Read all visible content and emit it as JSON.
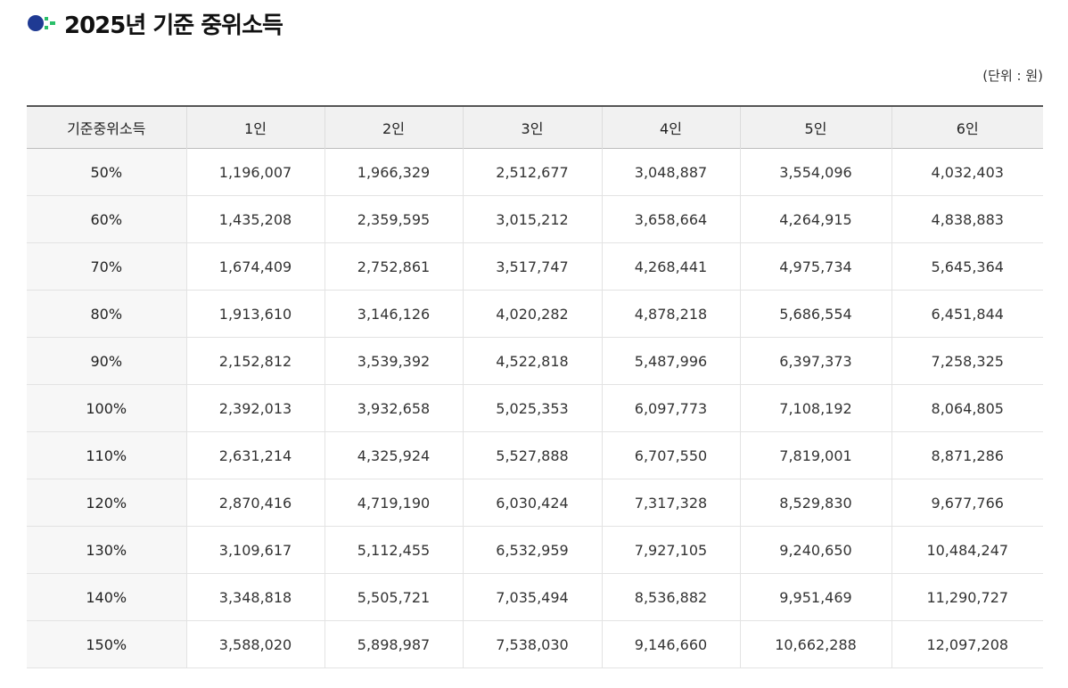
{
  "title": "2025년 기준 중위소득",
  "unit_note": "(단위 : 원)",
  "colors": {
    "icon_blue": "#1f3a93",
    "icon_green": "#2bbf6a",
    "header_bg": "#f1f1f1",
    "first_col_bg": "#f7f7f7"
  },
  "table": {
    "headers": [
      "기준중위소득",
      "1인",
      "2인",
      "3인",
      "4인",
      "5인",
      "6인"
    ],
    "rows": [
      [
        "50%",
        "1,196,007",
        "1,966,329",
        "2,512,677",
        "3,048,887",
        "3,554,096",
        "4,032,403"
      ],
      [
        "60%",
        "1,435,208",
        "2,359,595",
        "3,015,212",
        "3,658,664",
        "4,264,915",
        "4,838,883"
      ],
      [
        "70%",
        "1,674,409",
        "2,752,861",
        "3,517,747",
        "4,268,441",
        "4,975,734",
        "5,645,364"
      ],
      [
        "80%",
        "1,913,610",
        "3,146,126",
        "4,020,282",
        "4,878,218",
        "5,686,554",
        "6,451,844"
      ],
      [
        "90%",
        "2,152,812",
        "3,539,392",
        "4,522,818",
        "5,487,996",
        "6,397,373",
        "7,258,325"
      ],
      [
        "100%",
        "2,392,013",
        "3,932,658",
        "5,025,353",
        "6,097,773",
        "7,108,192",
        "8,064,805"
      ],
      [
        "110%",
        "2,631,214",
        "4,325,924",
        "5,527,888",
        "6,707,550",
        "7,819,001",
        "8,871,286"
      ],
      [
        "120%",
        "2,870,416",
        "4,719,190",
        "6,030,424",
        "7,317,328",
        "8,529,830",
        "9,677,766"
      ],
      [
        "130%",
        "3,109,617",
        "5,112,455",
        "6,532,959",
        "7,927,105",
        "9,240,650",
        "10,484,247"
      ],
      [
        "140%",
        "3,348,818",
        "5,505,721",
        "7,035,494",
        "8,536,882",
        "9,951,469",
        "11,290,727"
      ],
      [
        "150%",
        "3,588,020",
        "5,898,987",
        "7,538,030",
        "9,146,660",
        "10,662,288",
        "12,097,208"
      ]
    ]
  }
}
